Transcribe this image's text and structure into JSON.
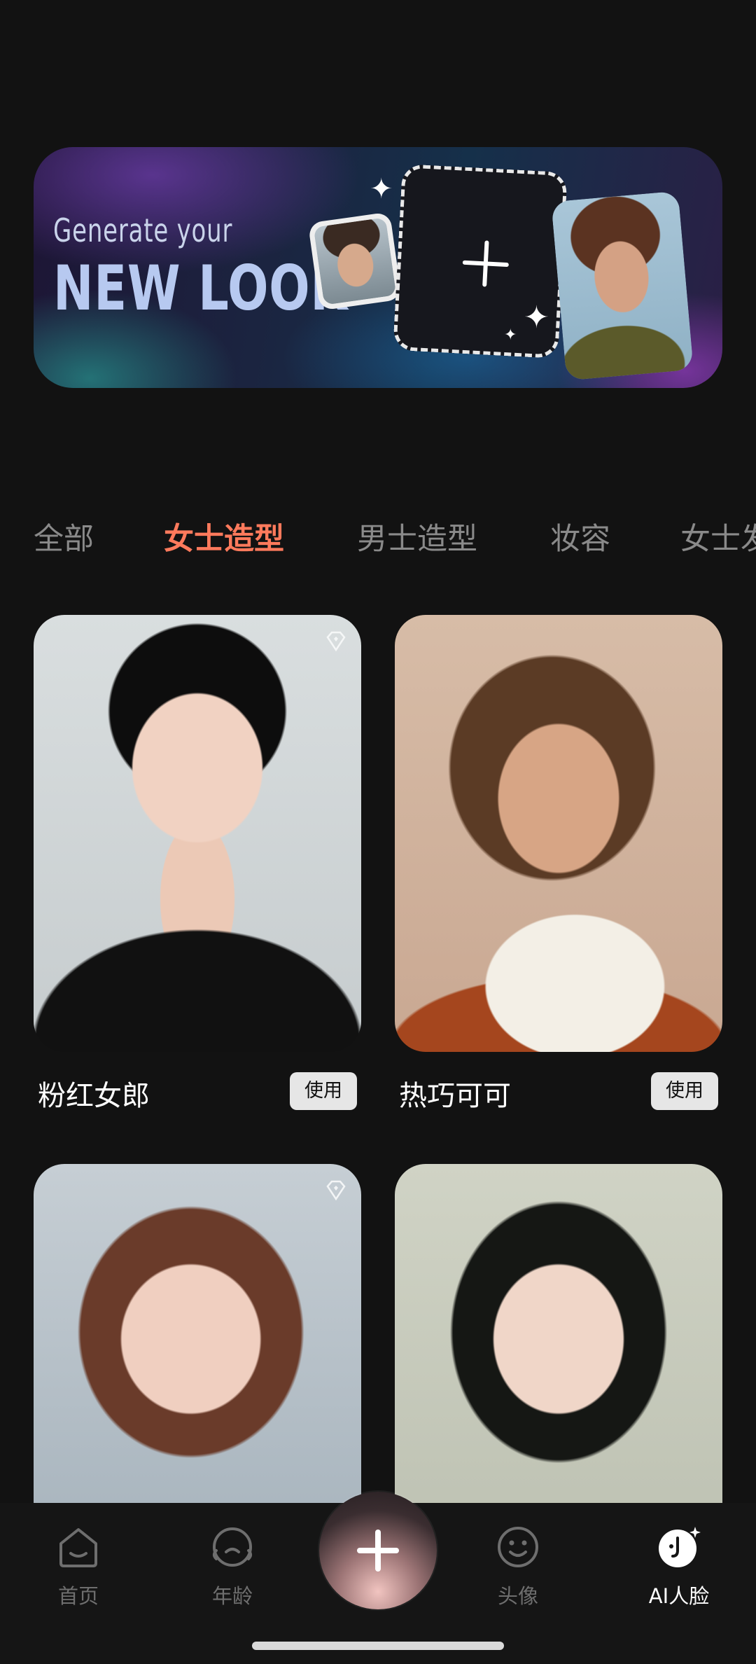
{
  "banner": {
    "line1": "Generate your",
    "line2": "NEW LOOK"
  },
  "tabs": [
    {
      "label": "全部",
      "active": false
    },
    {
      "label": "女士造型",
      "active": true
    },
    {
      "label": "男士造型",
      "active": false
    },
    {
      "label": "妆容",
      "active": false
    },
    {
      "label": "女士发",
      "active": false
    }
  ],
  "styles": [
    {
      "name": "粉红女郎",
      "button": "使用",
      "premium": true
    },
    {
      "name": "热巧可可",
      "button": "使用",
      "premium": false
    },
    {
      "name": "",
      "button": "",
      "premium": true
    },
    {
      "name": "",
      "button": "",
      "premium": false
    }
  ],
  "nav": {
    "items": [
      {
        "label": "首页",
        "icon": "home-icon"
      },
      {
        "label": "年龄",
        "icon": "age-face-icon"
      },
      {
        "label": "头像",
        "icon": "smile-face-icon"
      },
      {
        "label": "AI人脸",
        "icon": "ai-face-icon",
        "active": true
      }
    ],
    "center_icon": "plus-icon"
  },
  "colors": {
    "background": "#121212",
    "accent": "#ff7a5c",
    "tab_inactive": "#8a8a8a"
  }
}
